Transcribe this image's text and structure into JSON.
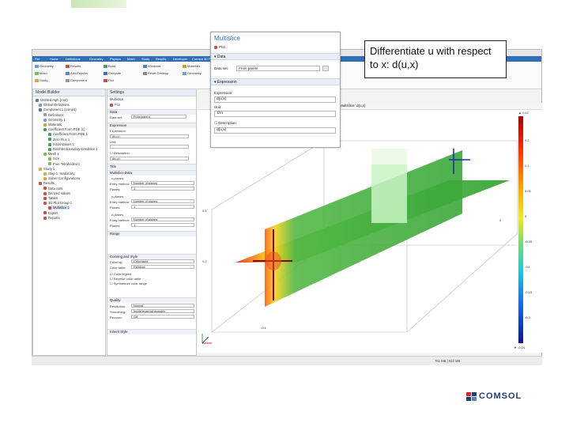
{
  "callout": {
    "text": "Differentiate u with respect to x: d(u,x)"
  },
  "logo": {
    "text": "COMSOL"
  },
  "menu": {
    "tabs": [
      "File",
      "Home",
      "Definitions",
      "Geometry",
      "Physics",
      "Mesh",
      "Study",
      "Results",
      "Developer",
      "Comsol 3D Plot"
    ]
  },
  "ribbon": {
    "items": [
      "Geometry",
      "Mesh",
      "Study",
      "Results",
      "Add Physics",
      "Component",
      "Build",
      "Compute",
      "Plot",
      "Windows",
      "Reset Desktop",
      "Materials",
      "Geometry"
    ]
  },
  "model_builder": {
    "title": "Model Builder",
    "tree": [
      "Untitled.mph (root)",
      "Global Definitions",
      "Component 1 (comp1)",
      "Definitions",
      "Geometry 1",
      "Materials",
      "Coefficient Form PDE (c)",
      "Coefficient Form PDE 1",
      "Zero Flux 1",
      "Initial Values 1",
      "Dirichlet Boundary Condition 1",
      "Mesh 1",
      "Size",
      "Free Tetrahedral 1",
      "Study 1",
      "Step 1: Stationary",
      "Solver Configurations",
      "Results",
      "Data Sets",
      "Derived Values",
      "Tables",
      "3D Plot Group 1",
      "Multislice 1",
      "Export",
      "Reports"
    ]
  },
  "settings": {
    "title": "Settings",
    "subtitle": "Multislice",
    "plot_label": "Plot",
    "sections": {
      "data": "Data",
      "expression": "Expression",
      "title": "Title",
      "multislice_data": "Multislice Data",
      "range": "Range",
      "coloring": "Coloring and Style",
      "quality": "Quality",
      "inherit": "Inherit Style"
    },
    "fields": {
      "dataset_label": "Data set:",
      "dataset_value": "From parent",
      "expression_label": "Expression:",
      "expression_value": "d(u,x)",
      "unit_label": "Unit:",
      "description_label": "Description",
      "description_value": "d(u,x)",
      "x_planes": "x-planes",
      "y_planes": "y-planes",
      "z_planes": "z-planes",
      "entry_label": "Entry method:",
      "entry_value": "Number of planes",
      "planes_label": "Planes:",
      "planes_value": "1",
      "coloring_label": "Coloring:",
      "coloring_value": "Color table",
      "color_table_label": "Color table:",
      "color_table_value": "Rainbow",
      "color_legend": "Color legend",
      "reverse": "Reverse color table",
      "symmetrize": "Symmetrize color range",
      "resolution_label": "Resolution:",
      "resolution_value": "Normal",
      "smoothing_label": "Smoothing:",
      "smoothing_value": "Inside material domains",
      "recover_label": "Recover:",
      "recover_value": "Off"
    }
  },
  "multislice_popup": {
    "title": "Multislice",
    "plot": "Plot",
    "data_section": "Data",
    "dataset_label": "Data set:",
    "dataset_value": "From parent",
    "expression_section": "Expression",
    "expression_label": "Expression:",
    "expression_value": "d(u,x)",
    "unit_label": "Unit:",
    "unit_value": "1/m",
    "description_label": "Description",
    "description_value": "d(u,x)"
  },
  "graphics": {
    "header": "Multislice: d(u,x)",
    "max_label": "▲ 0.42",
    "min_label": "▼ -0.24",
    "axis_labels": [
      "0.5",
      "0.2",
      "0",
      "-0.1"
    ],
    "colorbar_ticks": [
      "0.2",
      "0.1",
      "0.05",
      "0",
      "-0.05",
      "-0.1",
      "-0.15",
      "-0.2"
    ]
  },
  "status": {
    "text": "761 MB | 922 MB"
  },
  "colors": {
    "accent": "#2f6fb5",
    "slice_green": "#3faa3a",
    "slice_light": "#c6f2c0",
    "logo": "#1f3e79",
    "logo_mark": "#d7262b"
  }
}
